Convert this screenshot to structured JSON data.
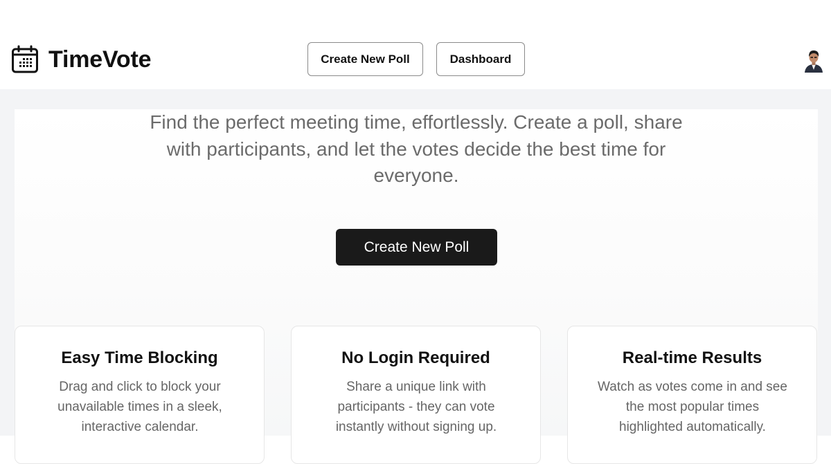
{
  "header": {
    "app_name": "TimeVote",
    "logo_icon": "calendar-icon",
    "nav": {
      "create_poll_label": "Create New Poll",
      "dashboard_label": "Dashboard"
    },
    "avatar_icon": "user-avatar"
  },
  "hero": {
    "tagline": "Find the perfect meeting time, effortlessly. Create a poll, share with participants, and let the votes decide the best time for everyone.",
    "cta_label": "Create New Poll"
  },
  "features": [
    {
      "title": "Easy Time Blocking",
      "description": "Drag and click to block your unavailable times in a sleek, interactive calendar."
    },
    {
      "title": "No Login Required",
      "description": "Share a unique link with participants - they can vote instantly without signing up."
    },
    {
      "title": "Real-time Results",
      "description": "Watch as votes come in and see the most popular times highlighted automatically."
    }
  ],
  "colors": {
    "primary_button": "#1a1a1a",
    "page_background": "#f3f4f6",
    "text_muted": "#6b6b6b"
  }
}
